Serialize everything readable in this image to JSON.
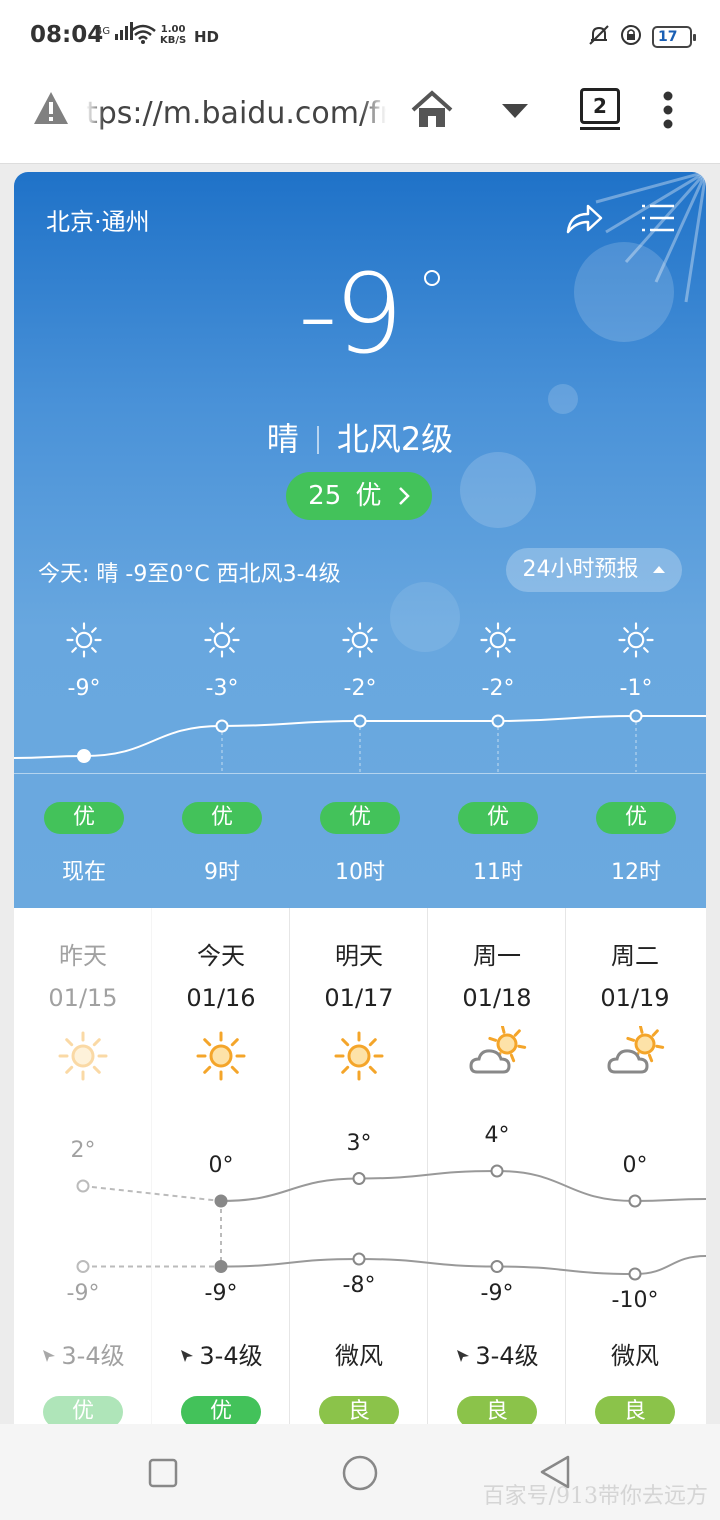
{
  "status_bar": {
    "time": "08:04",
    "signal": "4G",
    "net_speed": "1.00",
    "net_unit": "KB/S",
    "hd": "HD",
    "battery": "17"
  },
  "address_bar": {
    "url": "tps://m.baidu.com/fro",
    "tab_count": "2"
  },
  "weather": {
    "location": "北京·通州",
    "temperature": "-9",
    "condition": "晴",
    "wind": "北风2级",
    "aqi_value": "25",
    "aqi_label": "优",
    "today_summary": "今天:  晴  -9至0°C  西北风3-4级",
    "forecast_24h_button": "24小时预报"
  },
  "hourly": [
    {
      "temp": "-9°",
      "temp_value": -9,
      "aqi": "优",
      "time": "现在",
      "icon": "sun-icon"
    },
    {
      "temp": "-3°",
      "temp_value": -3,
      "aqi": "优",
      "time": "9时",
      "icon": "sun-icon"
    },
    {
      "temp": "-2°",
      "temp_value": -2,
      "aqi": "优",
      "time": "10时",
      "icon": "sun-icon"
    },
    {
      "temp": "-2°",
      "temp_value": -2,
      "aqi": "优",
      "time": "11时",
      "icon": "sun-icon"
    },
    {
      "temp": "-1°",
      "temp_value": -1,
      "aqi": "优",
      "time": "12时",
      "icon": "sun-icon"
    }
  ],
  "daily": [
    {
      "name": "昨天",
      "date": "01/15",
      "icon": "sun-icon",
      "high": "2°",
      "high_value": 2,
      "low": "-9°",
      "low_value": -9,
      "wind": "3-4级",
      "aqi": "优",
      "aqi_color": "#43c25a",
      "past": true
    },
    {
      "name": "今天",
      "date": "01/16",
      "icon": "sun-icon",
      "high": "0°",
      "high_value": 0,
      "low": "-9°",
      "low_value": -9,
      "wind": "3-4级",
      "aqi": "优",
      "aqi_color": "#43c25a",
      "past": false
    },
    {
      "name": "明天",
      "date": "01/17",
      "icon": "sun-icon",
      "high": "3°",
      "high_value": 3,
      "low": "-8°",
      "low_value": -8,
      "wind": "微风",
      "aqi": "良",
      "aqi_color": "#8bc34a",
      "past": false
    },
    {
      "name": "周一",
      "date": "01/18",
      "icon": "partly-cloudy-icon",
      "high": "4°",
      "high_value": 4,
      "low": "-9°",
      "low_value": -9,
      "wind": "3-4级",
      "aqi": "良",
      "aqi_color": "#8bc34a",
      "past": false
    },
    {
      "name": "周二",
      "date": "01/19",
      "icon": "partly-cloudy-icon",
      "high": "0°",
      "high_value": 0,
      "low": "-10°",
      "low_value": -10,
      "wind": "微风",
      "aqi": "良",
      "aqi_color": "#8bc34a",
      "past": false
    }
  ],
  "watermark": "百家号/913带你去远方"
}
